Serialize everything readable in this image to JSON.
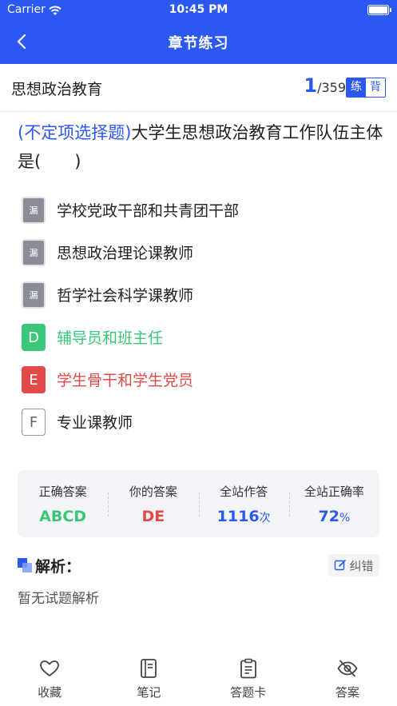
{
  "status": {
    "carrier": "Carrier",
    "time": "10:45 PM"
  },
  "nav": {
    "title": "章节练习",
    "back_icon": "chevron-left-icon"
  },
  "subhead": {
    "chapter": "思想政治教育",
    "current": "1",
    "total": "/359",
    "mode_practice": "练",
    "mode_recite": "背"
  },
  "question": {
    "type": "(不定项选择题)",
    "text": "大学生思想政治教育工作队伍主体是(　　)"
  },
  "options": [
    {
      "badge": "漏",
      "text": "学校党政干部和共青团干部",
      "state": "missed"
    },
    {
      "badge": "漏",
      "text": "思想政治理论课教师",
      "state": "missed"
    },
    {
      "badge": "漏",
      "text": "哲学社会科学课教师",
      "state": "missed"
    },
    {
      "badge": "D",
      "text": "辅导员和班主任",
      "state": "correct"
    },
    {
      "badge": "E",
      "text": "学生骨干和学生党员",
      "state": "wrong"
    },
    {
      "badge": "F",
      "text": "专业课教师",
      "state": "none"
    }
  ],
  "stats": [
    {
      "label": "正确答案",
      "value": "ABCD",
      "unit": "",
      "color": "#3ac77a"
    },
    {
      "label": "你的答案",
      "value": "DE",
      "unit": "",
      "color": "#e24a4a"
    },
    {
      "label": "全站作答",
      "value": "1116",
      "unit": "次",
      "color": "#2b58f0"
    },
    {
      "label": "全站正确率",
      "value": "72",
      "unit": "%",
      "color": "#2b58f0"
    }
  ],
  "analysis": {
    "title": "解析：",
    "report_label": "纠错",
    "body": "暂无试题解析"
  },
  "tabbar": [
    {
      "label": "收藏",
      "icon": "heart-icon"
    },
    {
      "label": "笔记",
      "icon": "notebook-icon"
    },
    {
      "label": "答题卡",
      "icon": "clipboard-icon"
    },
    {
      "label": "答案",
      "icon": "eye-off-icon"
    }
  ],
  "colors": {
    "primary": "#2b58f0",
    "correct": "#3ac77a",
    "wrong": "#e24a4a",
    "missed": "#8a8d98"
  }
}
